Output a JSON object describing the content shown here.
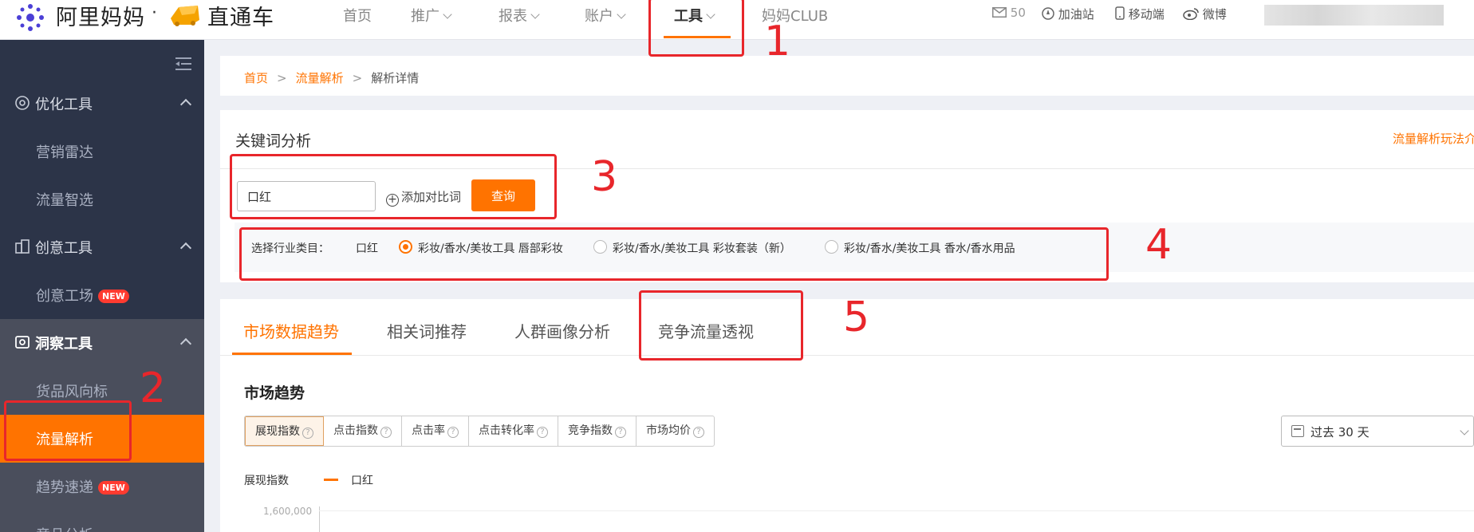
{
  "brand": {
    "alimama": "阿里妈妈",
    "dot": "·",
    "product": "直通车"
  },
  "nav": [
    {
      "label": "首页",
      "has_chevron": false,
      "active": false
    },
    {
      "label": "推广",
      "has_chevron": true,
      "active": false
    },
    {
      "label": "报表",
      "has_chevron": true,
      "active": false
    },
    {
      "label": "账户",
      "has_chevron": true,
      "active": false
    },
    {
      "label": "工具",
      "has_chevron": true,
      "active": true
    },
    {
      "label": "妈妈CLUB",
      "has_chevron": false,
      "active": false
    }
  ],
  "top_right": {
    "messages": "50",
    "gas_station": "加油站",
    "mobile": "移动端",
    "weibo": "微博"
  },
  "sidebar": {
    "groups": [
      {
        "label": "优化工具",
        "icon": "dial-icon",
        "items": [
          "营销雷达",
          "流量智选"
        ]
      },
      {
        "label": "创意工具",
        "icon": "building-icon",
        "items": [
          "创意工场"
        ]
      },
      {
        "label": "洞察工具",
        "icon": "binoculars-icon",
        "items": [
          "货品风向标",
          "流量解析",
          "趋势速递",
          "竞品分析"
        ]
      }
    ],
    "new_badge": "NEW",
    "active_item": "流量解析"
  },
  "breadcrumb": {
    "home": "首页",
    "parent": "流量解析",
    "current": "解析详情",
    "sep": ">"
  },
  "keyword_analysis": {
    "title": "关键词分析",
    "help_link": "流量解析玩法介",
    "input_value": "口红",
    "add_compare": "添加对比词",
    "query_button": "查询"
  },
  "industry": {
    "label": "选择行业类目：",
    "keyword": "口红",
    "options": [
      {
        "label": "彩妆/香水/美妆工具 唇部彩妆",
        "selected": true
      },
      {
        "label": "彩妆/香水/美妆工具 彩妆套装（新）",
        "selected": false
      },
      {
        "label": "彩妆/香水/美妆工具 香水/香水用品",
        "selected": false
      }
    ]
  },
  "tabs": [
    "市场数据趋势",
    "相关词推荐",
    "人群画像分析",
    "竞争流量透视"
  ],
  "market": {
    "title": "市场趋势",
    "metrics": [
      "展现指数",
      "点击指数",
      "点击率",
      "点击转化率",
      "竞争指数",
      "市场均价"
    ],
    "date_range": "过去 30 天",
    "legend_y": "展现指数",
    "legend_series": "口红",
    "y_tick_top": "1,600,000"
  },
  "annotations": [
    "1",
    "2",
    "3",
    "4",
    "5"
  ],
  "colors": {
    "accent": "#ff7300",
    "sidebar_bg": "#2c3448",
    "annotation_red": "#e8262b"
  }
}
